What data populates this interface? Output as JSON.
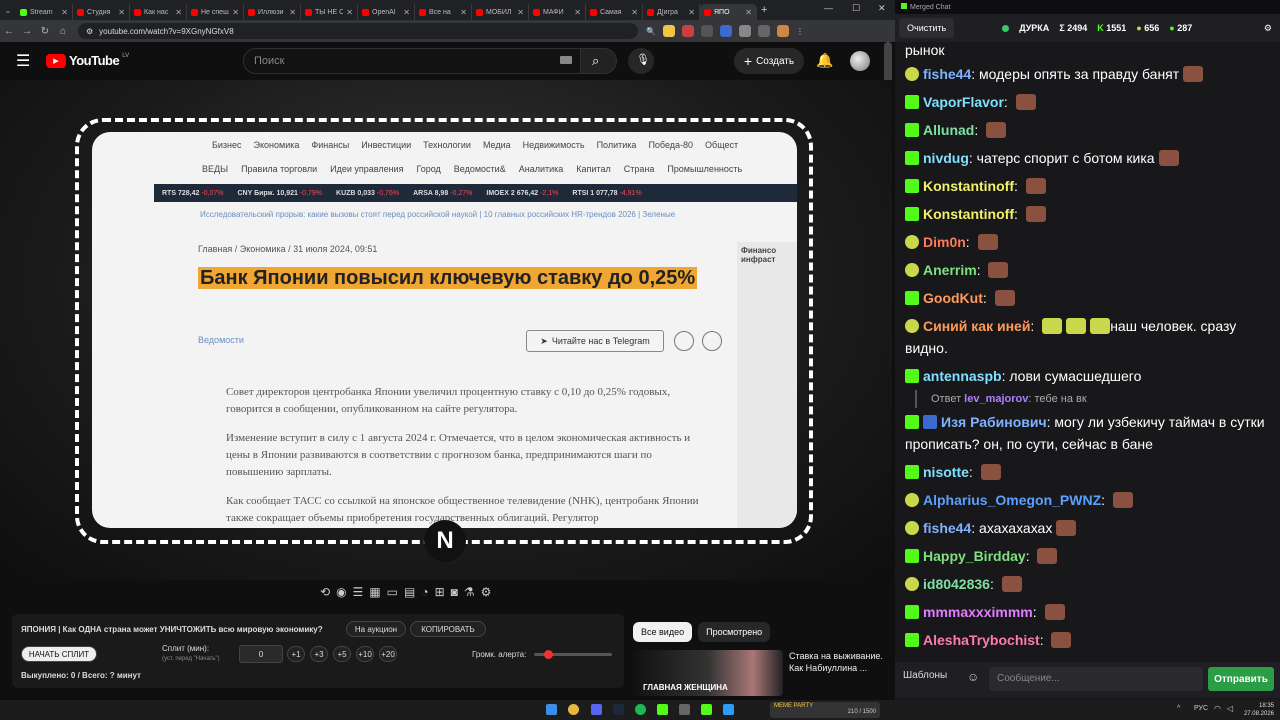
{
  "browser": {
    "tabs": [
      {
        "label": "Stream",
        "color": "#53fc18"
      },
      {
        "label": "Студия",
        "color": "#ff0000"
      },
      {
        "label": "Как нас",
        "color": "#ff0000"
      },
      {
        "label": "Не спеш",
        "color": "#ff0000"
      },
      {
        "label": "Иллюзи",
        "color": "#ff0000"
      },
      {
        "label": "ТЫ НЕ С",
        "color": "#ff0000"
      },
      {
        "label": "OpenAI",
        "color": "#ff0000"
      },
      {
        "label": "Все на",
        "color": "#ff0000"
      },
      {
        "label": "МОБИЛ",
        "color": "#ff0000"
      },
      {
        "label": "МАФИ",
        "color": "#ff0000"
      },
      {
        "label": "Самая",
        "color": "#ff0000"
      },
      {
        "label": "Д[игра",
        "color": "#ff0000"
      },
      {
        "label": "ЯПО",
        "color": "#ff0000"
      }
    ],
    "url": "youtube.com/watch?v=9XGnyNGfxV8"
  },
  "youtube": {
    "logo": "YouTube",
    "region": "LV",
    "search_placeholder": "Поиск",
    "create_label": "Создать"
  },
  "article": {
    "nav1": [
      "Бизнес",
      "Экономика",
      "Финансы",
      "Инвестиции",
      "Технологии",
      "Медиа",
      "Недвижимость",
      "Политика",
      "Победа-80",
      "Общест"
    ],
    "nav2": [
      "ВЕДЫ",
      "Правила торговли",
      "Идеи управления",
      "Город",
      "Ведомости&",
      "Аналитика",
      "Капитал",
      "Страна",
      "Промышленность"
    ],
    "ticker": [
      {
        "text": "RTS 728,42",
        "chg": "-0,07%",
        "dir": "dn"
      },
      {
        "text": "CNY Бирж. 10,921",
        "chg": "-0,79%",
        "dir": "dn"
      },
      {
        "text": "KUZB 0,033",
        "chg": "-0,76%",
        "dir": "dn"
      },
      {
        "text": "ARSA 8,98",
        "chg": "-0,27%",
        "dir": "dn"
      },
      {
        "text": "IMOEX 2 676,42",
        "chg": "-2,1%",
        "dir": "dn"
      },
      {
        "text": "RTSI 1 077,78",
        "chg": "-4,91%",
        "dir": "dn"
      }
    ],
    "crumbs_line": "Исследовательский прорыв: какие вызовы стоят перед российской наукой   |   10 главных российских HR-трендов 2026   |   Зеленые",
    "crumb": "Главная / Экономика / 31 июля 2024, 09:51",
    "headline": "Банк Японии повысил ключевую ставку до 0,25%",
    "source": "Ведомости",
    "telegram": "Читайте нас в Telegram",
    "paragraphs": [
      "Совет директоров центробанка Японии увеличил процентную ставку с 0,10 до 0,25% годовых, говорится в сообщении, опубликованном на сайте регулятора.",
      "Изменение вступит в силу с 1 августа 2024 г. Отмечается, что в целом экономическая активность и цены в Японии развиваются в соответствии с прогнозом банка, предпринимаются шаги по повышению зарплаты.",
      "Как сообщает ТАСС со ссылкой на японское общественное телевидение (NHK), центробанк Японии также сокращает объемы приобретения государственных облигаций. Регулятор"
    ],
    "side": "Финансо инфраст"
  },
  "panel": {
    "title": "ЯПОНИЯ | Как ОДНА страна может УНИЧТОЖИТЬ всю мировую экономику?",
    "auction": "На аукцион",
    "copy": "КОПИРОВАТЬ",
    "start_split": "НАЧАТЬ СПЛИТ",
    "split_label": "Сплит (мин):",
    "split_hint": "(уст. перед \"Начать\")",
    "split_value": "0",
    "increments": [
      "+1",
      "+3",
      "+5",
      "+10",
      "+20"
    ],
    "volume_label": "Громк. алерта:",
    "bought": "Выкуплено: 0 / Всего: ? минут"
  },
  "recs": {
    "pills": [
      "Все видео",
      "Просмотрено"
    ],
    "thumb_text": "ГЛАВНАЯ ЖЕНЩИНА",
    "title": "Ставка на выживание. Как Набиуллина ..."
  },
  "chat": {
    "window_title": "Merged Chat",
    "clear": "Очистить",
    "channel": "ДУРКА",
    "stats": [
      "Σ 2494",
      "1551",
      "656",
      "287"
    ],
    "first_line": "рынок",
    "messages": [
      {
        "badge": "tw",
        "user": "fishe44",
        "color": "#7fb2ff",
        "text": "модеры опять за правду банят"
      },
      {
        "badge": "kick",
        "user": "VaporFlavor",
        "color": "#7fe0ff",
        "text": ""
      },
      {
        "badge": "kick",
        "user": "Allunad",
        "color": "#7fe0a0",
        "text": ""
      },
      {
        "badge": "kick",
        "user": "nivdug",
        "color": "#7fe0ff",
        "text": "чатерс спорит с ботом кика"
      },
      {
        "badge": "kick",
        "user": "Konstantinoff",
        "color": "#f2f26a",
        "text": ""
      },
      {
        "badge": "kick",
        "user": "Konstantinoff",
        "color": "#f2f26a",
        "text": ""
      },
      {
        "badge": "tw",
        "user": "Dim0n",
        "color": "#ff7a5c",
        "text": ""
      },
      {
        "badge": "tw",
        "user": "Anerrim",
        "color": "#7fe07f",
        "text": ""
      },
      {
        "badge": "kick",
        "user": "GoodKut",
        "color": "#ff9a5c",
        "text": ""
      }
    ],
    "msg_long1": {
      "user": "Синий как иней",
      "color": "#ff9a5c",
      "text": "наш человек. сразу видно."
    },
    "msg_ant": {
      "user": "antennaspb",
      "color": "#7fe0ff",
      "text": "лови сумасшедшего"
    },
    "reply": {
      "prefix": "Ответ",
      "user": "lev_majorov",
      "text": "тебе на вк"
    },
    "msg_long2": {
      "user": "Изя Рабинович",
      "color": "#7fb2ff",
      "text": "могу ли узбекичу таймач в сутки прописать? он, по сути, сейчас в бане"
    },
    "messages2": [
      {
        "badge": "kick",
        "user": "nisotte",
        "color": "#7fe0ff",
        "text": ""
      },
      {
        "badge": "tw",
        "user": "Alpharius_Omegon_PWNZ",
        "color": "#5aa0ff",
        "text": ""
      },
      {
        "badge": "tw",
        "user": "fishe44",
        "color": "#7fb2ff",
        "text": "ахахахахах"
      },
      {
        "badge": "kick",
        "user": "Happy_Birdday",
        "color": "#7fe07f",
        "text": ""
      },
      {
        "badge": "tw",
        "user": "id8042836",
        "color": "#7fe0a0",
        "text": ""
      },
      {
        "badge": "kick",
        "user": "mmmaxxximmm",
        "color": "#e07fff",
        "text": ""
      },
      {
        "badge": "kick",
        "user": "AleshaTrybochist",
        "color": "#ff7ab0",
        "text": ""
      }
    ],
    "templates": "Шаблоны",
    "input_placeholder": "Сообщение...",
    "send": "Отправить"
  },
  "taskbar": {
    "lang": "РУС",
    "time": "18:35",
    "date": "27.08.2026",
    "overlay_label": "MEME PARTY",
    "overlay_count": "210 / 1500"
  }
}
